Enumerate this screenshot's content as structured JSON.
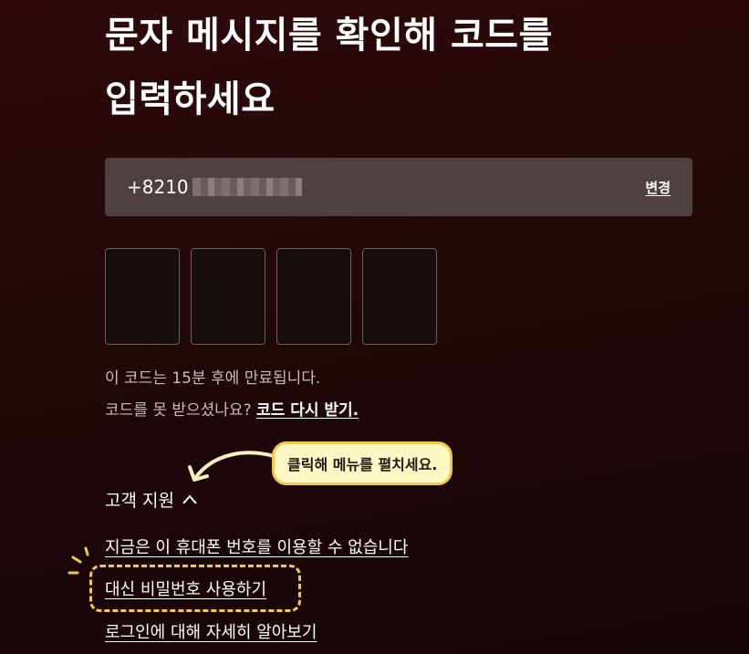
{
  "title_line1": "문자 메시지를 확인해 코드를",
  "title_line2": "입력하세요",
  "phone": {
    "number_visible": "+8210",
    "change_label": "변경"
  },
  "code_inputs": [
    "",
    "",
    "",
    ""
  ],
  "info": {
    "expiry_text": "이 코드는 15분 후에 만료됩니다.",
    "not_received_text": "코드를 못 받으셨나요? ",
    "resend_label": "코드 다시 받기."
  },
  "tooltip": {
    "text": "클릭해 메뉴를 펼치세요."
  },
  "support": {
    "toggle_label": "고객 지원",
    "links": [
      "지금은 이 휴대폰 번호를 이용할 수 없습니다",
      "대신 비밀번호 사용하기",
      "로그인에 대해 자세히 알아보기"
    ]
  },
  "colors": {
    "background": "#1f0708",
    "input_panel": "#50403f",
    "highlight": "#f2c94c",
    "tooltip_bg": "#fff8c5"
  },
  "icons": [
    "chevron-up-icon",
    "curved-arrow-icon",
    "sparkle-icon"
  ]
}
